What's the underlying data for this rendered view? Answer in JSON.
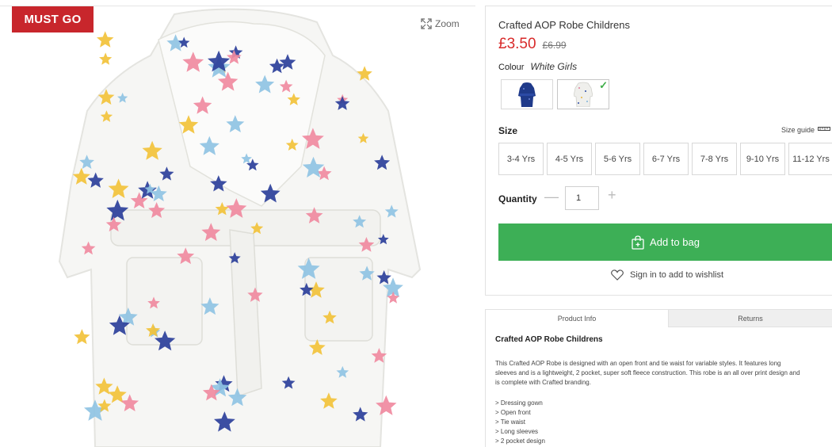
{
  "badge": {
    "text": "MUST GO"
  },
  "zoom": {
    "label": "Zoom"
  },
  "product": {
    "title": "Crafted AOP Robe Childrens",
    "price_now": "£3.50",
    "price_was": "£6.99",
    "colour_label": "Colour",
    "colour_value": "White Girls",
    "swatches": [
      {
        "name": "Navy",
        "icon": "navy-robe-thumbnail",
        "color": "#1f3a8a"
      },
      {
        "name": "White Girls",
        "icon": "white-robe-thumbnail",
        "selected": true
      }
    ],
    "size_label": "Size",
    "size_guide": "Size guide",
    "sizes": [
      "3-4 Yrs",
      "4-5 Yrs",
      "5-6 Yrs",
      "6-7 Yrs",
      "7-8 Yrs",
      "9-10 Yrs",
      "11-12 Yrs"
    ],
    "quantity_label": "Quantity",
    "quantity_value": "1",
    "add_to_bag": "Add to bag",
    "wishlist": "Sign in to add to wishlist"
  },
  "info": {
    "tabs": [
      "Product Info",
      "Returns"
    ],
    "title": "Crafted AOP Robe Childrens",
    "description_lines": [
      "This Crafted AOP Robe is designed with an open front and tie waist for variable styles. It features long",
      "sleeves and is a lightweight, 2 pocket, super soft fleece construction. This robe is an all over print design and",
      "is complete with Crafted branding."
    ],
    "bullets": [
      "> Dressing gown",
      "> Open front",
      "> Tie waist",
      "> Long sleeves",
      "> 2 pocket design"
    ]
  },
  "colors": {
    "badge_red": "#c8262c",
    "price_red": "#d82a2a",
    "bag_green": "#3daf56",
    "tick_green": "#3fae49"
  }
}
